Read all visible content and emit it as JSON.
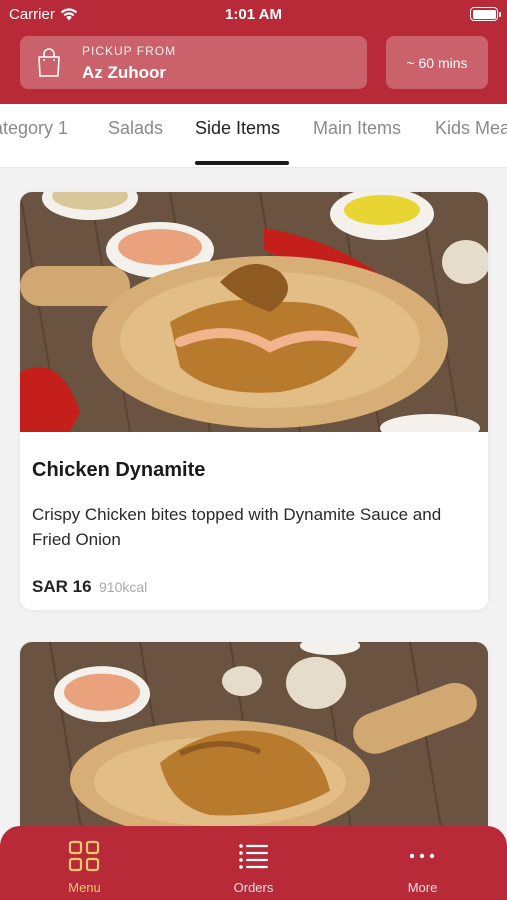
{
  "status_bar": {
    "carrier": "Carrier",
    "time": "1:01 AM"
  },
  "header": {
    "pickup_label": "PICKUP FROM",
    "pickup_location": "Az Zuhoor",
    "eta": "~ 60 mins"
  },
  "tabs": [
    {
      "label": "ategory 1"
    },
    {
      "label": "Salads"
    },
    {
      "label": "Side Items",
      "active": true
    },
    {
      "label": "Main Items"
    },
    {
      "label": "Kids Meal"
    }
  ],
  "menu_items": [
    {
      "name": "Chicken Dynamite",
      "description": "Crispy Chicken bites topped with Dynamite Sauce and Fried Onion",
      "price": "SAR 16",
      "calories": "910kcal"
    }
  ],
  "bottom_nav": [
    {
      "label": "Menu",
      "icon": "grid-icon",
      "active": true
    },
    {
      "label": "Orders",
      "icon": "list-icon"
    },
    {
      "label": "More",
      "icon": "more-icon"
    }
  ],
  "colors": {
    "brand": "#b82a38",
    "active_nav": "#f2c76e"
  }
}
